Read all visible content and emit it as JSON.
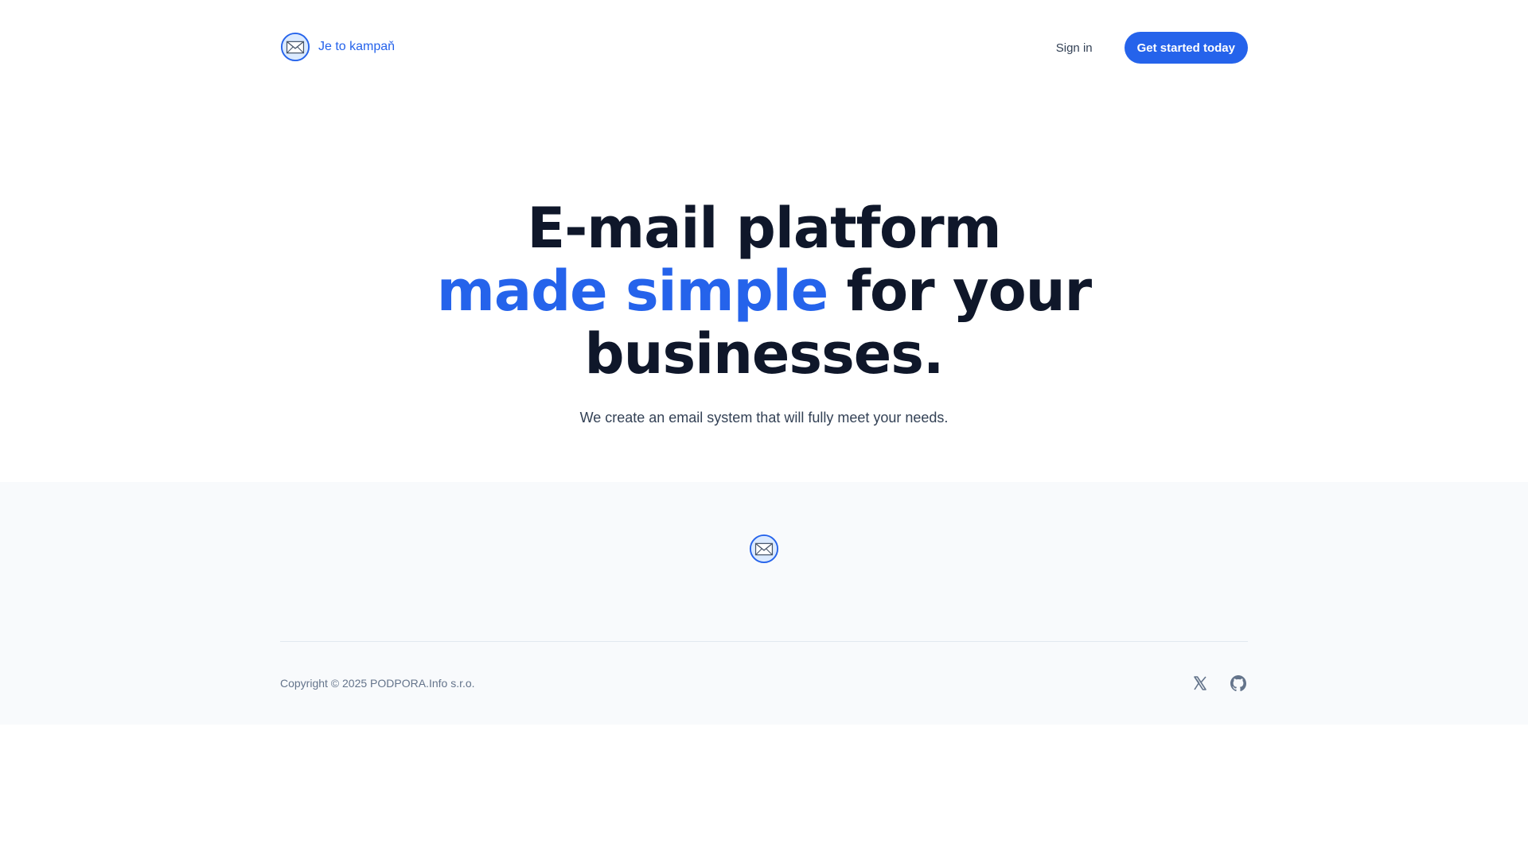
{
  "header": {
    "brand_name": "Je to kampaň",
    "sign_in_label": "Sign in",
    "cta_label": "Get started today"
  },
  "hero": {
    "title_line1": "E-mail platform",
    "title_accent": "made simple",
    "title_rest": " for your",
    "title_line3": "businesses.",
    "subtitle": "We create an email system that will fully meet your needs."
  },
  "footer": {
    "copyright": "Copyright © 2025 PODPORA.Info s.r.o.",
    "social_icons": [
      "x-icon",
      "github-icon"
    ]
  },
  "colors": {
    "accent": "#2563eb",
    "heading": "#0f172a",
    "body_text": "#334155",
    "footer_bg": "#f8fafc",
    "underline": "#93c5fd"
  }
}
